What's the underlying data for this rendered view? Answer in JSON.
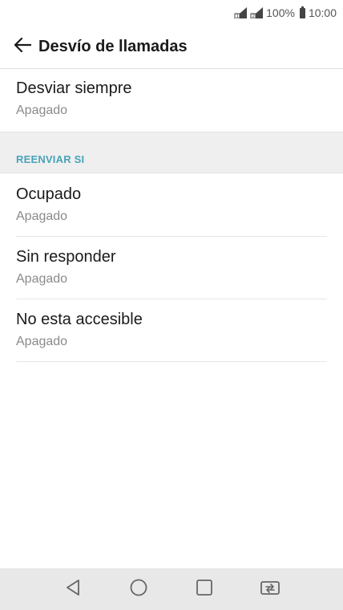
{
  "status_bar": {
    "battery_percent": "100%",
    "time": "10:00"
  },
  "app_bar": {
    "title": "Desvío de llamadas",
    "back_icon": "arrow-back-icon"
  },
  "items": [
    {
      "title": "Desviar siempre",
      "subtitle": "Apagado"
    }
  ],
  "section": {
    "label": "REENVIAR SI",
    "items": [
      {
        "title": "Ocupado",
        "subtitle": "Apagado"
      },
      {
        "title": "Sin responder",
        "subtitle": "Apagado"
      },
      {
        "title": "No esta accesible",
        "subtitle": "Apagado"
      }
    ]
  },
  "colors": {
    "accent": "#4aa3b8",
    "section_bg": "#efefef",
    "nav_bg": "#e8e8e8"
  },
  "nav_bar": {
    "icons": [
      "back-triangle-icon",
      "home-circle-icon",
      "recents-square-icon",
      "dual-window-icon"
    ]
  }
}
